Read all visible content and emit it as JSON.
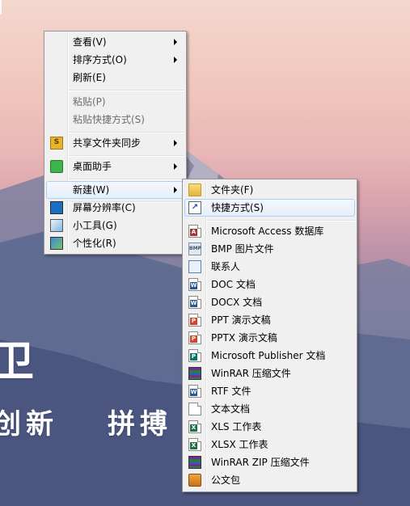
{
  "wallpaper": {
    "headline": "卫",
    "slogan_left": "创新",
    "slogan_right": "拼搏"
  },
  "context_menu": {
    "items": [
      {
        "label": "查看(V)",
        "submenu": true
      },
      {
        "label": "排序方式(O)",
        "submenu": true
      },
      {
        "label": "刷新(E)"
      },
      {
        "label": "粘贴(P)",
        "disabled": true
      },
      {
        "label": "粘贴快捷方式(S)",
        "disabled": true
      },
      {
        "label": "共享文件夹同步",
        "submenu": true,
        "icon": "sync-icon"
      },
      {
        "label": "桌面助手",
        "submenu": true,
        "icon": "desktop-helper-icon"
      },
      {
        "label": "新建(W)",
        "submenu": true,
        "highlighted": true
      },
      {
        "label": "屏幕分辨率(C)",
        "icon": "screen-resolution-icon"
      },
      {
        "label": "小工具(G)",
        "icon": "gadgets-icon"
      },
      {
        "label": "个性化(R)",
        "icon": "personalize-icon"
      }
    ]
  },
  "new_submenu": {
    "items": [
      {
        "label": "文件夹(F)",
        "icon": "folder-icon"
      },
      {
        "label": "快捷方式(S)",
        "icon": "shortcut-icon",
        "highlighted": true
      },
      {
        "label": "Microsoft Access 数据库",
        "icon": "access-icon"
      },
      {
        "label": "BMP 图片文件",
        "icon": "bmp-icon"
      },
      {
        "label": "联系人",
        "icon": "contact-icon"
      },
      {
        "label": "DOC 文档",
        "icon": "doc-icon"
      },
      {
        "label": "DOCX 文档",
        "icon": "docx-icon"
      },
      {
        "label": "PPT 演示文稿",
        "icon": "ppt-icon"
      },
      {
        "label": "PPTX 演示文稿",
        "icon": "pptx-icon"
      },
      {
        "label": "Microsoft Publisher 文档",
        "icon": "publisher-icon"
      },
      {
        "label": "WinRAR 压缩文件",
        "icon": "winrar-icon"
      },
      {
        "label": "RTF 文件",
        "icon": "rtf-icon"
      },
      {
        "label": "文本文档",
        "icon": "text-document-icon"
      },
      {
        "label": "XLS 工作表",
        "icon": "xls-icon"
      },
      {
        "label": "XLSX 工作表",
        "icon": "xlsx-icon"
      },
      {
        "label": "WinRAR ZIP 压缩文件",
        "icon": "winrar-zip-icon"
      },
      {
        "label": "公文包",
        "icon": "briefcase-icon"
      }
    ]
  },
  "colors": {
    "menu_bg": "#f0f0f0",
    "menu_border": "#979797",
    "highlight_border": "#aecff7",
    "disabled_text": "#6d6d6d"
  }
}
